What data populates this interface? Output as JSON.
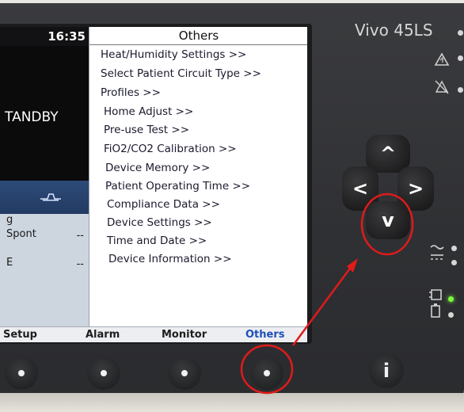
{
  "device": {
    "brand": "Vivo 45LS"
  },
  "status_bar": {
    "time": "16:35"
  },
  "main_panel": {
    "mode_text": "TANDBY",
    "parameters": [
      {
        "label": "g",
        "value": ""
      },
      {
        "label": "Spont",
        "value": "--"
      },
      {
        "label": "E",
        "value": "--"
      }
    ]
  },
  "menu": {
    "title": "Others",
    "items": [
      "Heat/Humidity Settings >>",
      "Select Patient Circuit Type >>",
      "Profiles >>",
      "Home Adjust >>",
      "Pre-use Test >>",
      "FiO2/CO2 Calibration >>",
      "Device Memory >>",
      "Patient Operating Time >>",
      "Compliance Data >>",
      "Device Settings >>",
      "Time and Date >>",
      "Device Information >>"
    ]
  },
  "tabs": [
    {
      "label": "Setup",
      "active": false
    },
    {
      "label": "Alarm",
      "active": false
    },
    {
      "label": "Monitor",
      "active": false
    },
    {
      "label": "Others",
      "active": true
    }
  ],
  "dpad": {
    "up": "^",
    "left": "<",
    "right": ">",
    "down": "v"
  },
  "info_button": {
    "label": "i"
  },
  "indicators": {
    "alarm_icon": "alarm-triangle-icon",
    "alarm_mute_icon": "alarm-mute-icon",
    "power_icon": "ac-dc-power-icon",
    "battery_icon": "battery-icon"
  },
  "colors": {
    "active_tab": "#1f4fb8",
    "annotation": "#e01b1b",
    "power_led": "#7cfc3c"
  }
}
